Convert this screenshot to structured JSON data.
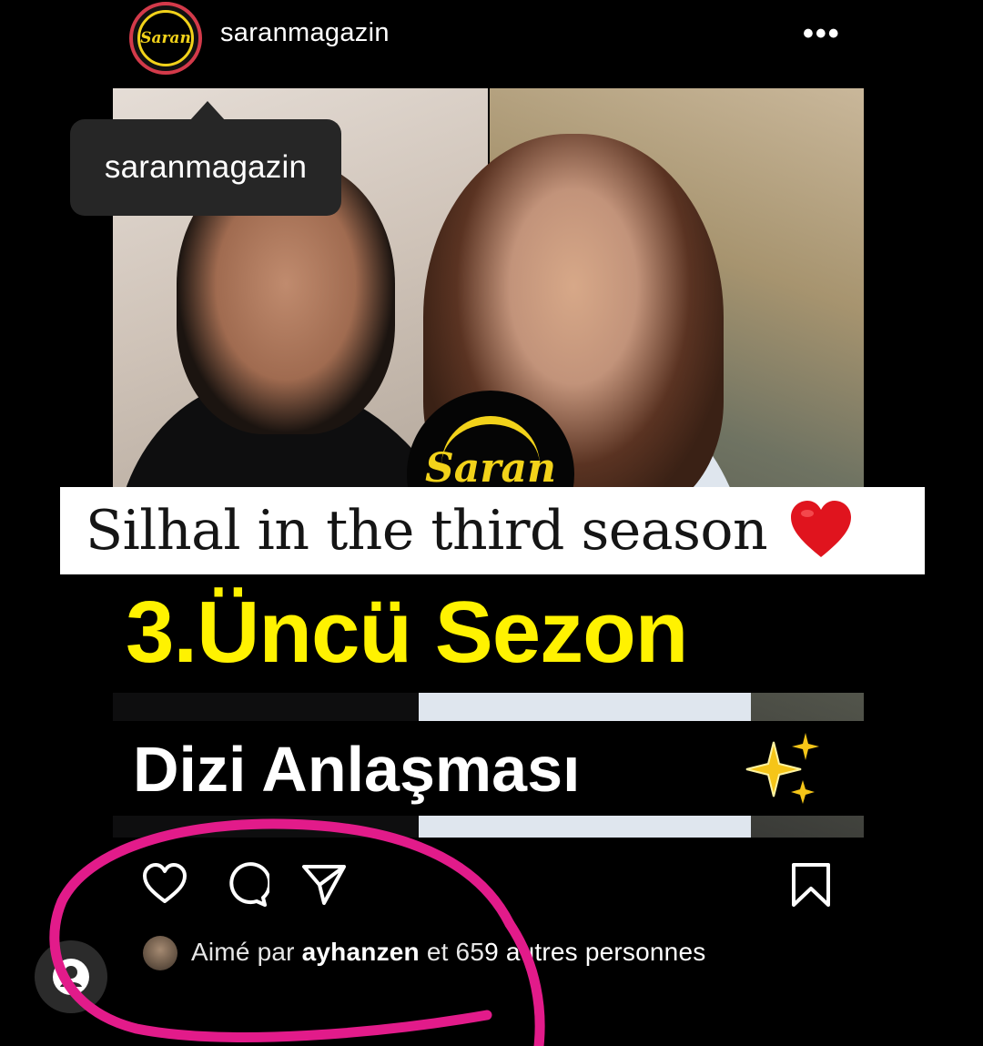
{
  "header": {
    "avatar_text": "Saran",
    "username": "saranmagazin",
    "more_label": "•••"
  },
  "post": {
    "logo_text": "Saran",
    "banner_text": "Silhal in the third season",
    "headline": "3.Üncü Sezon",
    "subheadline": "Dizi Anlaşması"
  },
  "tooltip": {
    "text": "saranmagazin"
  },
  "actions": {
    "like_icon": "heart-icon",
    "comment_icon": "comment-icon",
    "share_icon": "send-icon",
    "save_icon": "bookmark-icon"
  },
  "likes": {
    "prefix": "Aimé par",
    "user": "ayhanzen",
    "middle": "et 65",
    "suffix": "9 autres personnes"
  },
  "colors": {
    "background": "#000000",
    "headline_yellow": "#fff200",
    "annotation_pink": "#e21b8a",
    "tooltip_bg": "#262626"
  }
}
